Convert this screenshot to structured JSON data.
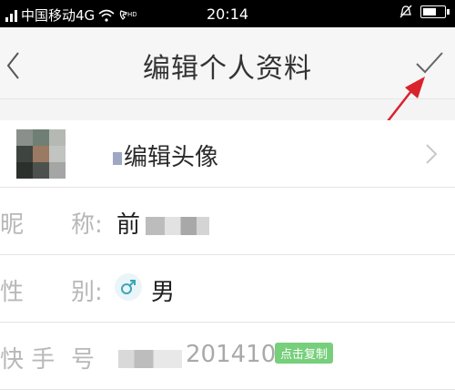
{
  "status_bar": {
    "carrier": "中国移动4G",
    "time": "20:14",
    "icons": [
      "signal-icon",
      "wifi-icon",
      "volte-icon",
      "alarm-icon",
      "battery-icon"
    ]
  },
  "nav": {
    "title": "编辑个人资料",
    "icons": [
      "back-icon",
      "check-icon"
    ]
  },
  "annotation": {
    "color": "#d9232d",
    "icon": "red-arrow-annotation"
  },
  "avatar_row": {
    "label": "编辑头像",
    "icon": "chevron-right-icon"
  },
  "fields": {
    "nickname": {
      "label_1": "昵",
      "label_2": "称:",
      "value": "前"
    },
    "gender": {
      "label_1": "性",
      "label_2": "别:",
      "value": "男",
      "icon": "male-icon"
    },
    "kuaishou": {
      "label_1": "快 手",
      "label_2": "号",
      "value_suffix": "201410",
      "copy_label": "点击复制"
    }
  },
  "colors": {
    "copy_badge": "#77cf7b",
    "male_icon": "#3aa6b9",
    "status_bar": "#000000"
  }
}
